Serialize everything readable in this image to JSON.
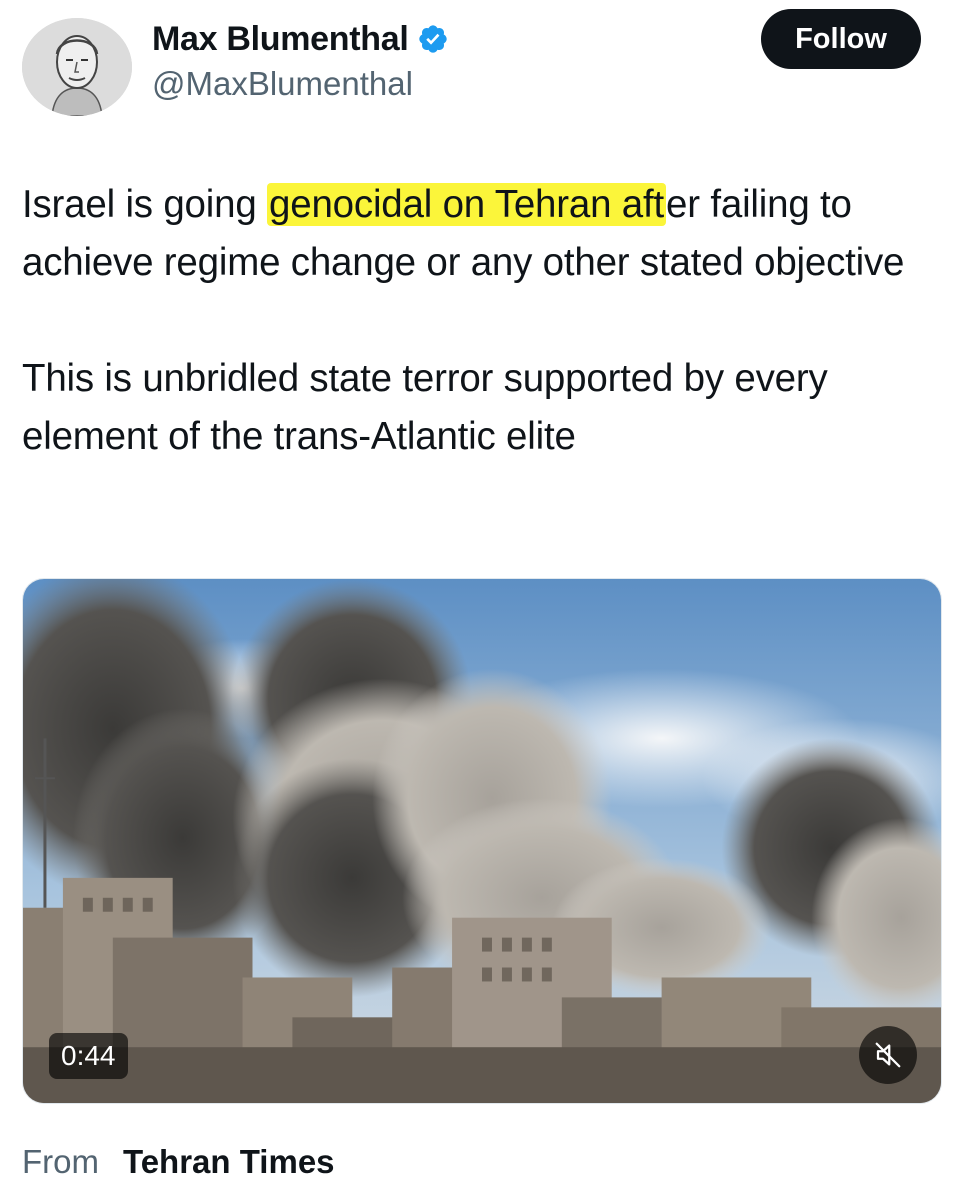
{
  "author": {
    "display_name": "Max Blumenthal",
    "handle": "@MaxBlumenthal",
    "verified": true,
    "avatar_icon": "avatar-sketch-portrait",
    "verified_icon": "verified-badge-icon"
  },
  "follow_button": {
    "label": "Follow"
  },
  "tweet": {
    "paragraph1_before": "Israel is going ",
    "paragraph1_highlight": "genocidal on Tehran aft",
    "paragraph1_after": "er failing to achieve regime change or any other stated objective",
    "paragraph2": "This is unbridled state terror supported by every element of the trans-Atlantic elite"
  },
  "media": {
    "type": "video",
    "duration": "0:44",
    "mute_icon": "speaker-muted-icon"
  },
  "source": {
    "prefix": "From",
    "name": "Tehran Times"
  },
  "colors": {
    "text_primary": "#0f1419",
    "text_secondary": "#536471",
    "verified_blue": "#1d9bf0",
    "highlight_yellow": "#fbf53a",
    "follow_button_bg": "#0f1419"
  }
}
